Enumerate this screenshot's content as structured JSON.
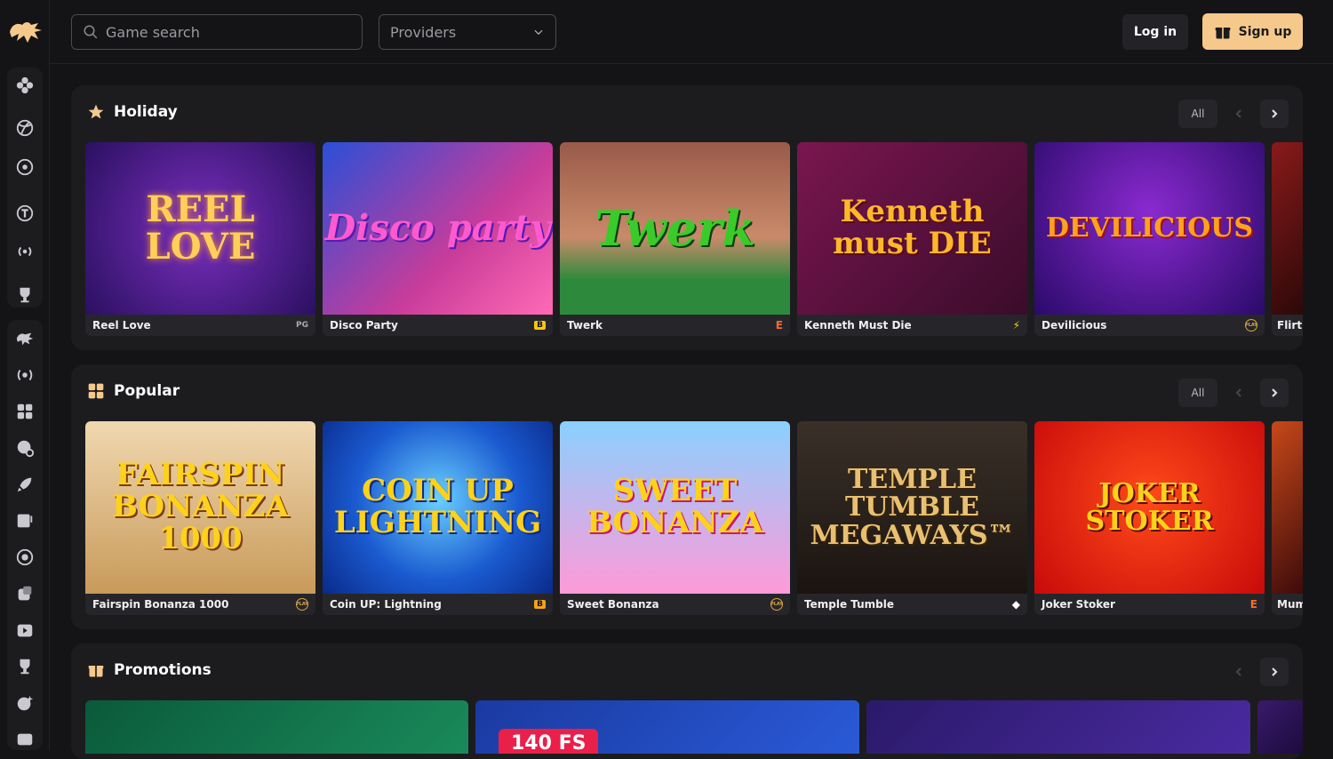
{
  "header": {
    "search_placeholder": "Game search",
    "providers_label": "Providers",
    "login_label": "Log in",
    "signup_label": "Sign up"
  },
  "sidebar": {
    "icons": [
      "clover-icon",
      "volleyball-icon",
      "roulette-icon",
      "tournament-icon",
      "live-signal-icon",
      "trophy-icon",
      "lion-icon",
      "live-stream-icon",
      "grid-icon",
      "poker-chip-icon",
      "rocket-icon",
      "slot-machine-icon",
      "wheel-icon",
      "dice-icon",
      "video-icon",
      "cup-icon",
      "bonus-icon",
      "id-card-icon"
    ]
  },
  "sections": [
    {
      "title": "Holiday",
      "icon": "star-icon",
      "all_label": "All",
      "games": [
        {
          "name": "Reel Love",
          "art": "REEL LOVE",
          "provider": "PG"
        },
        {
          "name": "Disco Party",
          "art": "Disco party",
          "provider": "B"
        },
        {
          "name": "Twerk",
          "art": "Twerk",
          "provider": "E"
        },
        {
          "name": "Kenneth Must Die",
          "art": "Kenneth must DIE",
          "provider": "⚡"
        },
        {
          "name": "Devilicious",
          "art": "DEVILICIOUS",
          "provider": "PLAY"
        },
        {
          "name": "Flirti",
          "art": "",
          "provider": ""
        }
      ]
    },
    {
      "title": "Popular",
      "icon": "grid-icon",
      "all_label": "All",
      "games": [
        {
          "name": "Fairspin Bonanza 1000",
          "art": "FAIRSPIN BONANZA 1000",
          "provider": "PLAY"
        },
        {
          "name": "Coin UP: Lightning",
          "art": "COIN UP LIGHTNING",
          "provider": "B"
        },
        {
          "name": "Sweet Bonanza",
          "art": "SWEET BONANZA",
          "provider": "PLAY"
        },
        {
          "name": "Temple Tumble",
          "art": "TEMPLE TUMBLE MEGAWAYS™",
          "provider": "◆"
        },
        {
          "name": "Joker Stoker",
          "art": "JOKER STOKER",
          "provider": "E"
        },
        {
          "name": "Mum",
          "art": "",
          "provider": ""
        }
      ]
    },
    {
      "title": "Promotions",
      "icon": "gift-icon",
      "promo_badge": "140 FS"
    }
  ],
  "colors": {
    "bg": "#141416",
    "panel": "#1c1c1f",
    "signup_bg": "#f5c98c"
  }
}
